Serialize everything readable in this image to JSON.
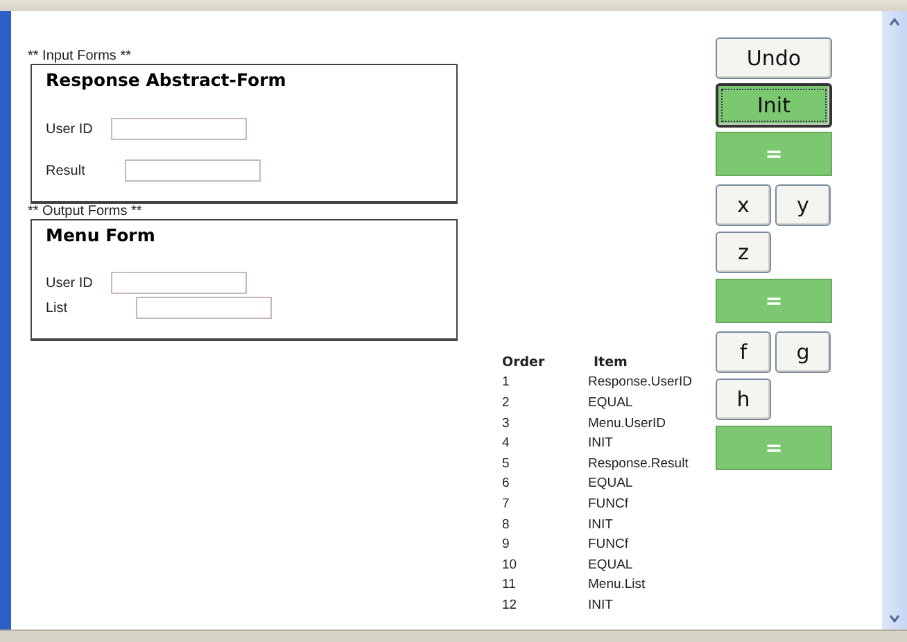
{
  "input_section": {
    "heading": "** Input Forms **",
    "form": {
      "title": "Response Abstract-Form",
      "fields": [
        {
          "label": "User ID"
        },
        {
          "label": "Result"
        }
      ]
    }
  },
  "output_section": {
    "heading": "** Output Forms **",
    "form": {
      "title": "Menu Form",
      "fields": [
        {
          "label": "User ID"
        },
        {
          "label": "List"
        }
      ]
    }
  },
  "order_table": {
    "columns": [
      "Order",
      "Item"
    ],
    "rows": [
      [
        "1",
        "Response.UserID"
      ],
      [
        "2",
        "EQUAL"
      ],
      [
        "3",
        "Menu.UserID"
      ],
      [
        "4",
        "INIT"
      ],
      [
        "5",
        "Response.Result"
      ],
      [
        "6",
        "EQUAL"
      ],
      [
        "7",
        "FUNCf"
      ],
      [
        "8",
        "INIT"
      ],
      [
        "9",
        "FUNCf"
      ],
      [
        "10",
        "EQUAL"
      ],
      [
        "11",
        "Menu.List"
      ],
      [
        "12",
        "INIT"
      ]
    ]
  },
  "button_rows": [
    [
      {
        "label": "Undo",
        "kind": "wide",
        "focused": false
      }
    ],
    [
      {
        "label": "Init",
        "kind": "green",
        "focused": true
      }
    ],
    [
      {
        "label": "=",
        "kind": "bar",
        "focused": false
      }
    ],
    [
      {
        "label": "x",
        "kind": "small",
        "focused": false
      },
      {
        "label": "y",
        "kind": "small",
        "focused": false
      }
    ],
    [
      {
        "label": "z",
        "kind": "small",
        "focused": false
      }
    ],
    [
      {
        "label": "=",
        "kind": "bar",
        "focused": false
      }
    ],
    [
      {
        "label": "f",
        "kind": "small",
        "focused": false
      },
      {
        "label": "g",
        "kind": "small",
        "focused": false
      }
    ],
    [
      {
        "label": "h",
        "kind": "small",
        "focused": false
      }
    ],
    [
      {
        "label": "=",
        "kind": "bar",
        "focused": false
      }
    ]
  ]
}
